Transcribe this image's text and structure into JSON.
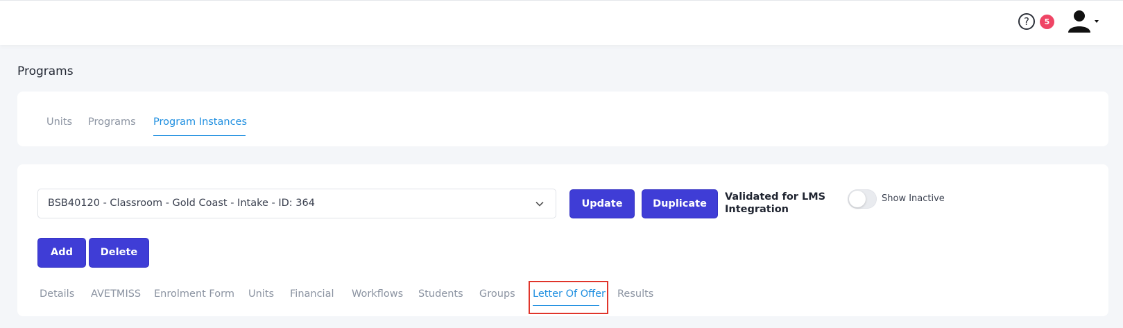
{
  "header": {
    "help_icon": "question-circle-icon",
    "help_glyph": "?",
    "notification_count": "5",
    "avatar_icon": "user-avatar-icon"
  },
  "page": {
    "title": "Programs"
  },
  "top_tabs": {
    "units": "Units",
    "programs": "Programs",
    "program_instances": "Program Instances",
    "active": "Program Instances"
  },
  "instance": {
    "selected": "BSB40120 - Classroom - Gold Coast - Intake - ID: 364",
    "update_label": "Update",
    "duplicate_label": "Duplicate",
    "validated_text": "Validated for LMS Integration",
    "show_inactive_label": "Show Inactive",
    "show_inactive_on": false,
    "add_label": "Add",
    "delete_label": "Delete"
  },
  "detail_tabs": {
    "details": "Details",
    "avetmiss": "AVETMISS",
    "enrolment_form": "Enrolment Form",
    "units": "Units",
    "financial": "Financial",
    "workflows": "Workflows",
    "students": "Students",
    "groups": "Groups",
    "letter_of_offer": "Letter Of Offer",
    "results": "Results",
    "active": "Letter Of Offer"
  },
  "colors": {
    "primary_button": "#3f3dd6",
    "active_tab": "#1f8fe0",
    "badge": "#ef4565",
    "highlight": "#e0352b"
  }
}
